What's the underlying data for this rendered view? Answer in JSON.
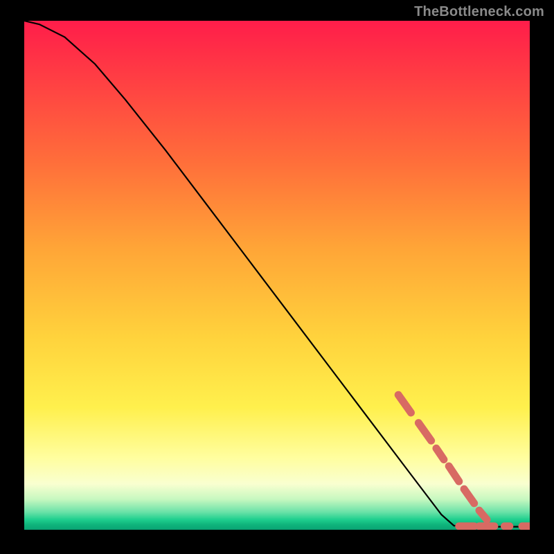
{
  "watermark": "TheBottleneck.com",
  "chart_data": {
    "type": "line",
    "title": "",
    "xlabel": "",
    "ylabel": "",
    "xlim": [
      0,
      100
    ],
    "ylim": [
      0,
      100
    ],
    "series": [
      {
        "name": "curve",
        "style": "solid-black",
        "points": [
          {
            "x": 0,
            "y": 100
          },
          {
            "x": 3,
            "y": 99.3
          },
          {
            "x": 8,
            "y": 96.8
          },
          {
            "x": 14,
            "y": 91.5
          },
          {
            "x": 20,
            "y": 84.5
          },
          {
            "x": 28,
            "y": 74.5
          },
          {
            "x": 36,
            "y": 64
          },
          {
            "x": 44,
            "y": 53.5
          },
          {
            "x": 52,
            "y": 43
          },
          {
            "x": 60,
            "y": 32.5
          },
          {
            "x": 68,
            "y": 22
          },
          {
            "x": 76,
            "y": 11.5
          },
          {
            "x": 82.5,
            "y": 3
          },
          {
            "x": 85,
            "y": 0.8
          },
          {
            "x": 90,
            "y": 0.6
          },
          {
            "x": 95,
            "y": 0.6
          },
          {
            "x": 100,
            "y": 0.6
          }
        ]
      },
      {
        "name": "markers",
        "style": "dotted-salmon-thick",
        "segments": [
          [
            {
              "x": 74,
              "y": 26.5
            },
            {
              "x": 76.5,
              "y": 23
            }
          ],
          [
            {
              "x": 78,
              "y": 21
            },
            {
              "x": 80.5,
              "y": 17.5
            }
          ],
          [
            {
              "x": 81.5,
              "y": 16
            },
            {
              "x": 83,
              "y": 13.8
            }
          ],
          [
            {
              "x": 84,
              "y": 12.5
            },
            {
              "x": 86,
              "y": 9.5
            }
          ],
          [
            {
              "x": 87,
              "y": 8
            },
            {
              "x": 89,
              "y": 5.2
            }
          ],
          [
            {
              "x": 90,
              "y": 3.8
            },
            {
              "x": 91.5,
              "y": 2
            }
          ],
          [
            {
              "x": 86,
              "y": 0.7
            },
            {
              "x": 89,
              "y": 0.7
            }
          ],
          [
            {
              "x": 90,
              "y": 0.7
            },
            {
              "x": 93,
              "y": 0.7
            }
          ],
          [
            {
              "x": 95,
              "y": 0.7
            },
            {
              "x": 96,
              "y": 0.7
            }
          ],
          [
            {
              "x": 98.5,
              "y": 0.7
            },
            {
              "x": 100,
              "y": 0.7
            }
          ]
        ]
      }
    ]
  }
}
